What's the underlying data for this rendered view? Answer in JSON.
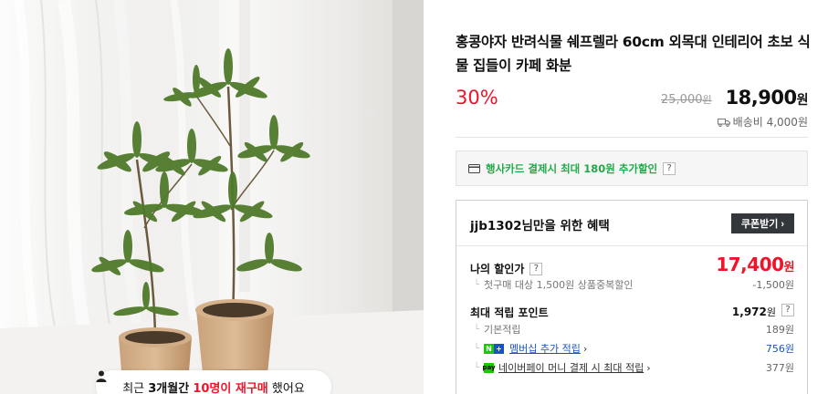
{
  "product": {
    "title": "홍콩야자 반려식물 쉐프렐라 60cm 외목대 인테리어 초보 식물 집들이 카페 화분",
    "discount": "30%",
    "original_price": "25,000",
    "original_unit": "원",
    "price": "18,900",
    "price_unit": "원",
    "shipping": "배송비 4,000원"
  },
  "repurchase": {
    "prefix": "최근",
    "period": "3개월간",
    "count": "10명이 재구매",
    "suffix": "했어요"
  },
  "card_promo": {
    "text": "행사카드 결제시 최대 180원 추가할인",
    "help": "?"
  },
  "benefit": {
    "heading": "jjb1302님만을 위한 혜택",
    "coupon_button": "쿠폰받기 ›",
    "my_discount_label": "나의 할인가",
    "my_discount_help": "?",
    "my_discount_amount": "17,400",
    "my_discount_unit": "원",
    "first_purchase_label": "첫구매 대상 1,500원 상품중복할인",
    "first_purchase_amount": "-1,500원",
    "max_point_label": "최대 적립 포인트",
    "max_point_amount": "1,972",
    "max_point_unit": "원",
    "max_point_help": "?",
    "basic_label": "기본적립",
    "basic_amount": "189원",
    "membership_label": "멤버십 추가 적립",
    "membership_amount": "756원",
    "npay_label": "네이버페이 머니 결제 시 최대 적립",
    "npay_amount": "377원"
  },
  "colors": {
    "accent_red": "#f0142a",
    "naver_green": "#1ec800",
    "link_blue": "#1a52c6",
    "button_dark": "#33363b"
  },
  "icons": [
    "person-icon",
    "truck-icon",
    "card-icon",
    "naver-plus-icon",
    "naver-pay-icon",
    "chevron-right-icon"
  ]
}
